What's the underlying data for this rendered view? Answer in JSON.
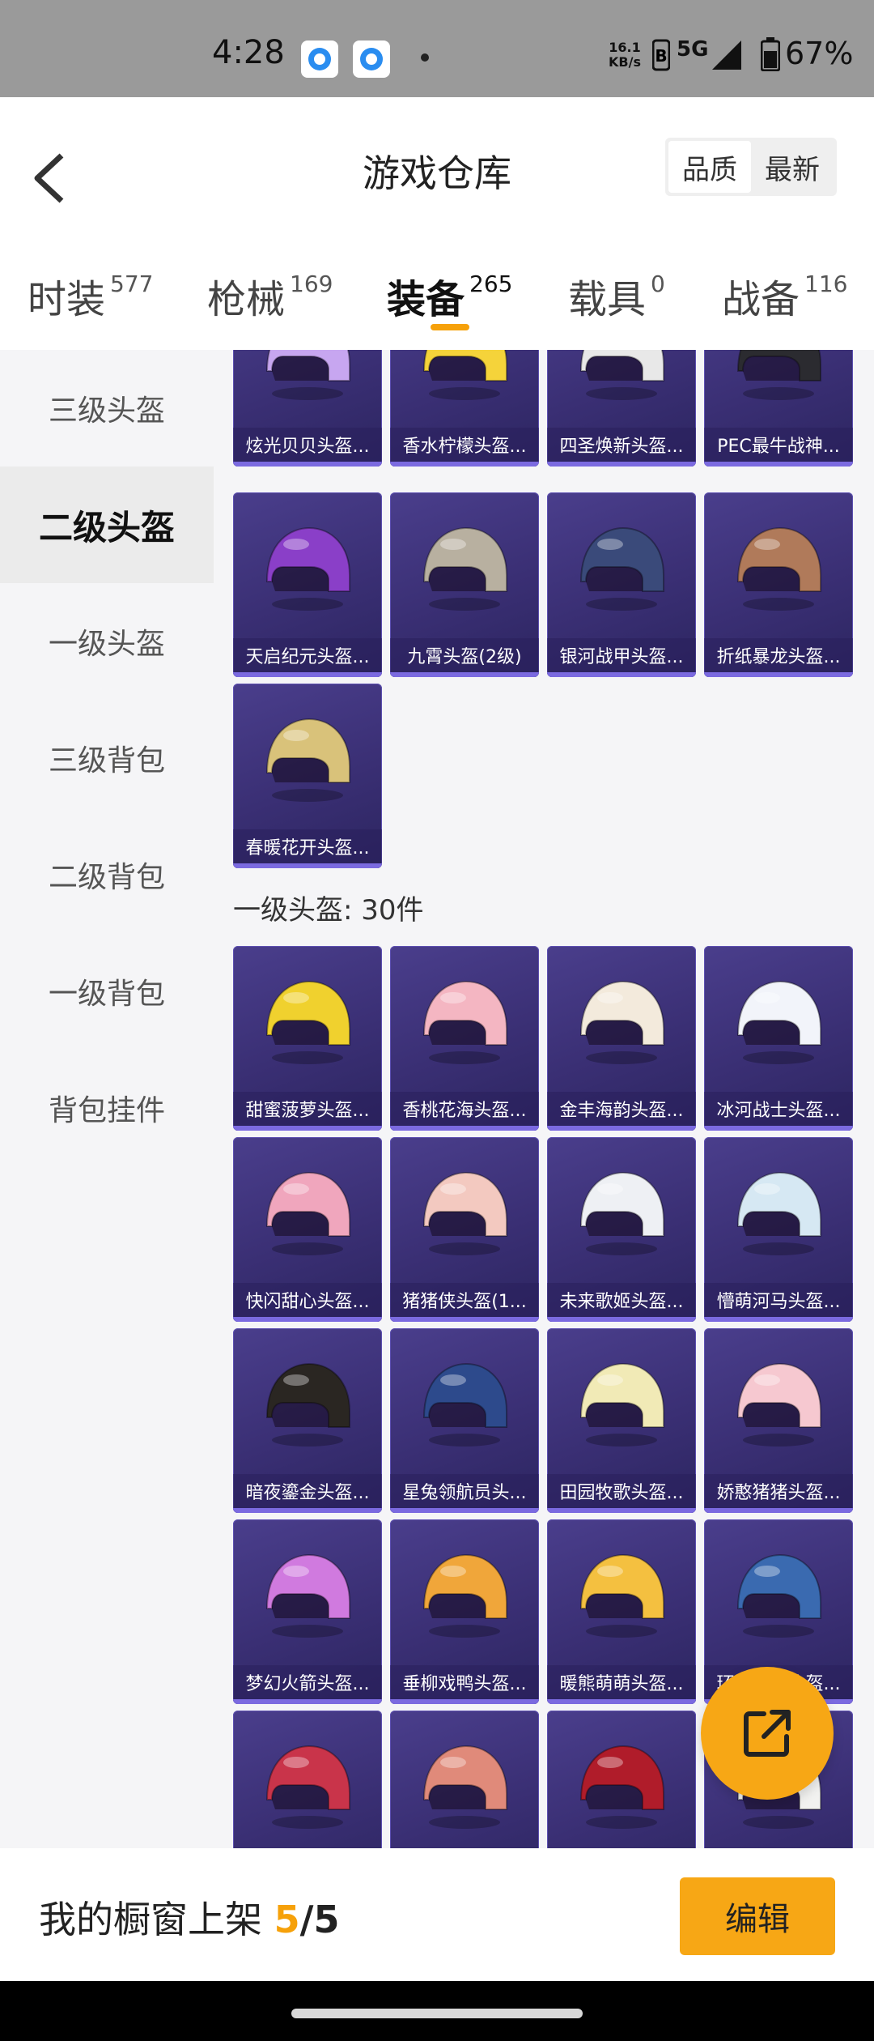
{
  "status_bar": {
    "time": "4:28",
    "net_speed_value": "16.1",
    "net_speed_unit": "KB/s",
    "network": "5G",
    "battery": "67%"
  },
  "header": {
    "title": "游戏仓库",
    "sort_options": [
      "品质",
      "最新"
    ],
    "active_sort": "品质"
  },
  "tabs": [
    {
      "label": "时装",
      "count": "577"
    },
    {
      "label": "枪械",
      "count": "169"
    },
    {
      "label": "装备",
      "count": "265",
      "active": true
    },
    {
      "label": "载具",
      "count": "0"
    },
    {
      "label": "战备",
      "count": "116"
    }
  ],
  "sidebar": {
    "items": [
      "三级头盔",
      "二级头盔",
      "一级头盔",
      "三级背包",
      "二级背包",
      "一级背包",
      "背包挂件"
    ],
    "active": "二级头盔"
  },
  "grid": {
    "top_items": [
      {
        "name": "炫光贝贝头盔...",
        "color": "#c7a6f0"
      },
      {
        "name": "香水柠檬头盔...",
        "color": "#f5d33a"
      },
      {
        "name": "四圣焕新头盔...",
        "color": "#e8e8e8"
      },
      {
        "name": "PEC最牛战神...",
        "color": "#2b2b30"
      },
      {
        "name": "天启纪元头盔...",
        "color": "#8a3fc8"
      },
      {
        "name": "九霄头盔(2级)",
        "color": "#b8b0a0"
      },
      {
        "name": "银河战甲头盔...",
        "color": "#3a4a7a"
      },
      {
        "name": "折纸暴龙头盔...",
        "color": "#b07a5a"
      },
      {
        "name": "春暖花开头盔...",
        "color": "#d9c27a"
      }
    ],
    "section_title": "一级头盔: 30件",
    "section_items": [
      {
        "name": "甜蜜菠萝头盔...",
        "color": "#f0d12e"
      },
      {
        "name": "香桃花海头盔...",
        "color": "#f4b6c2"
      },
      {
        "name": "金丰海韵头盔...",
        "color": "#f3eadc"
      },
      {
        "name": "冰河战士头盔...",
        "color": "#f2f4fa"
      },
      {
        "name": "快闪甜心头盔...",
        "color": "#f0a6bd"
      },
      {
        "name": "猪猪侠头盔(1...",
        "color": "#f3c9c0"
      },
      {
        "name": "未来歌姬头盔...",
        "color": "#eef0f4"
      },
      {
        "name": "懵萌河马头盔...",
        "color": "#d6e8f3"
      },
      {
        "name": "暗夜鎏金头盔...",
        "color": "#2a2622"
      },
      {
        "name": "星兔领航员头...",
        "color": "#2d4a8c"
      },
      {
        "name": "田园牧歌头盔...",
        "color": "#f1eab6"
      },
      {
        "name": "娇憨猪猪头盔...",
        "color": "#f6c8d0"
      },
      {
        "name": "梦幻火箭头盔...",
        "color": "#d07adf"
      },
      {
        "name": "垂柳戏鸭头盔...",
        "color": "#f0a63a"
      },
      {
        "name": "暖熊萌萌头盔...",
        "color": "#f4c040"
      },
      {
        "name": "环太平洋头盔...",
        "color": "#3a6ab0"
      },
      {
        "name": "",
        "color": "#c9344a"
      },
      {
        "name": "",
        "color": "#e08a7a"
      },
      {
        "name": "",
        "color": "#b01c2a"
      },
      {
        "name": "",
        "color": "#f2f2f0"
      }
    ]
  },
  "bottom_bar": {
    "shelf_label": "我的橱窗上架",
    "current": "5",
    "separator": "/",
    "total": "5",
    "edit_label": "编辑"
  },
  "colors": {
    "accent": "#f7a715",
    "card_bg": "#3a2f74"
  }
}
